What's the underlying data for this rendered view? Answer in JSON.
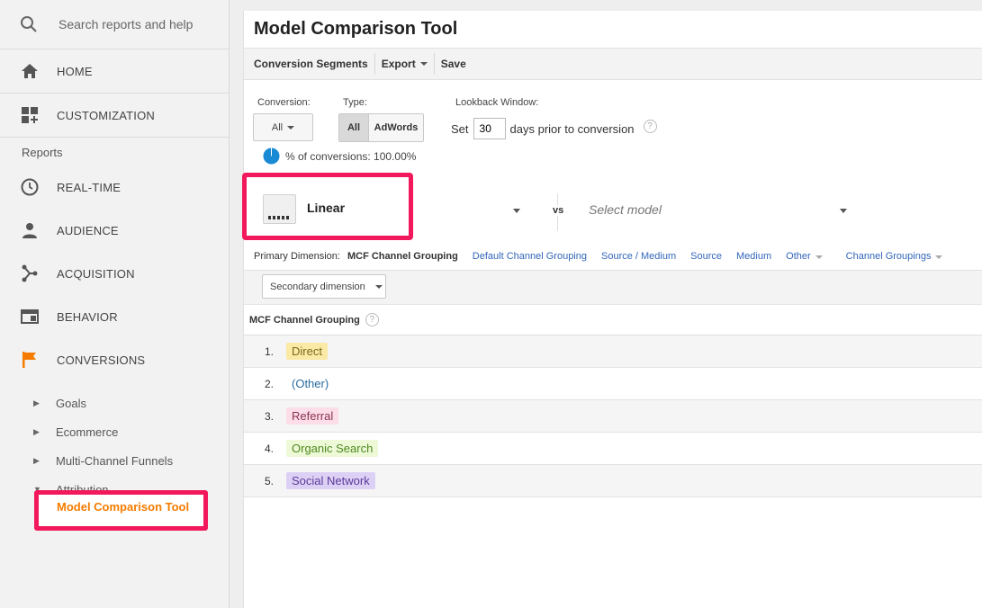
{
  "sidebar": {
    "search_placeholder": "Search reports and help",
    "home": "HOME",
    "customization": "CUSTOMIZATION",
    "reports_label": "Reports",
    "realtime": "REAL-TIME",
    "audience": "AUDIENCE",
    "acquisition": "ACQUISITION",
    "behavior": "BEHAVIOR",
    "conversions": "CONVERSIONS",
    "sub_items": [
      "Goals",
      "Ecommerce",
      "Multi-Channel Funnels",
      "Attribution"
    ],
    "active_item": "Model Comparison Tool"
  },
  "main": {
    "title": "Model Comparison Tool",
    "toolbar": {
      "segments": "Conversion Segments",
      "export": "Export",
      "save": "Save"
    },
    "conversion_label": "Conversion:",
    "conversion_value": "All",
    "type_label": "Type:",
    "type_all": "All",
    "type_adwords": "AdWords",
    "lookback_label": "Lookback Window:",
    "lookback_set": "Set",
    "lookback_days": "30",
    "lookback_suffix": "days prior to conversion",
    "help_glyph": "?",
    "pct_text": "% of conversions: 100.00%",
    "model_name": "Linear",
    "vs": "vs",
    "select_model": "Select model",
    "primary_dimension_label": "Primary Dimension:",
    "primary_dimension_current": "MCF Channel Grouping",
    "dimension_links": [
      "Default Channel Grouping",
      "Source / Medium",
      "Source",
      "Medium",
      "Other",
      "Channel Groupings"
    ],
    "secondary_dimension": "Secondary dimension",
    "column_header": "MCF Channel Grouping",
    "rows": [
      {
        "num": "1.",
        "label": "Direct"
      },
      {
        "num": "2.",
        "label": "(Other)"
      },
      {
        "num": "3.",
        "label": "Referral"
      },
      {
        "num": "4.",
        "label": "Organic Search"
      },
      {
        "num": "5.",
        "label": "Social Network"
      }
    ]
  },
  "colors": {
    "accent": "#f57c00",
    "highlight": "#f2185c",
    "link": "#3366bb",
    "pie": "#1a8ad4"
  }
}
